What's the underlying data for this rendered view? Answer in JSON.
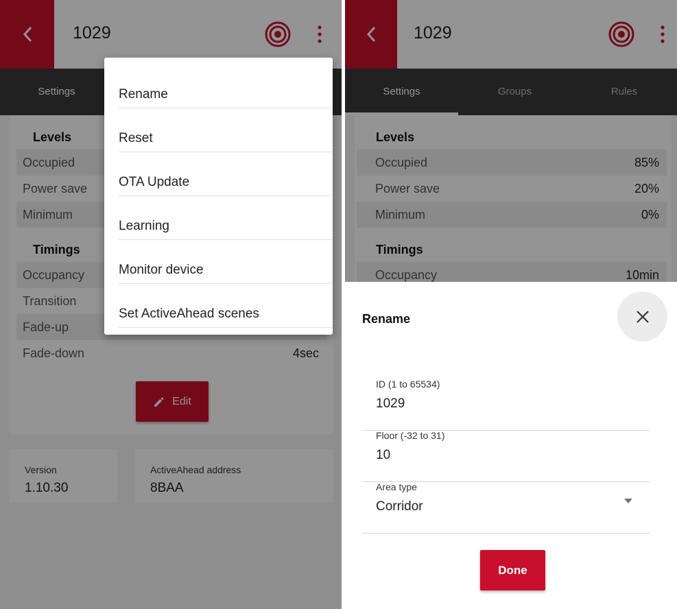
{
  "colors": {
    "brand_red": "#c8102e",
    "tab_bar": "#3a3a3a",
    "scrim": "rgba(0,0,0,0.42)"
  },
  "left": {
    "device_title": "1029",
    "tabs": [
      {
        "label": "Settings"
      }
    ],
    "levels": {
      "heading": "Levels",
      "rows": [
        {
          "label": "Occupied"
        },
        {
          "label": "Power save"
        },
        {
          "label": "Minimum"
        }
      ]
    },
    "timings": {
      "heading": "Timings",
      "rows": [
        {
          "label": "Occupancy"
        },
        {
          "label": "Transition"
        },
        {
          "label": "Fade-up"
        },
        {
          "label": "Fade-down",
          "value": "4sec"
        }
      ]
    },
    "edit_label": "Edit",
    "version": {
      "label": "Version",
      "value": "1.10.30"
    },
    "address": {
      "label": "ActiveAhead address",
      "value": "8BAA"
    },
    "menu": {
      "items": [
        {
          "label": "Rename"
        },
        {
          "label": "Reset"
        },
        {
          "label": "OTA Update"
        },
        {
          "label": "Learning"
        },
        {
          "label": "Monitor device"
        },
        {
          "label": "Set ActiveAhead scenes"
        }
      ]
    }
  },
  "right": {
    "device_title": "1029",
    "tabs": [
      {
        "label": "Settings",
        "active": true
      },
      {
        "label": "Groups"
      },
      {
        "label": "Rules"
      }
    ],
    "levels": {
      "heading": "Levels",
      "rows": [
        {
          "label": "Occupied",
          "value": "85%"
        },
        {
          "label": "Power save",
          "value": "20%"
        },
        {
          "label": "Minimum",
          "value": "0%"
        }
      ]
    },
    "timings": {
      "heading": "Timings",
      "rows": [
        {
          "label": "Occupancy",
          "value": "10min"
        }
      ]
    },
    "dialog": {
      "title": "Rename",
      "fields": [
        {
          "label": "ID (1 to 65534)",
          "value": "1029"
        },
        {
          "label": "Floor (-32 to 31)",
          "value": "10"
        },
        {
          "label": "Area type",
          "value": "Corridor",
          "type": "select"
        }
      ],
      "done_label": "Done"
    }
  }
}
